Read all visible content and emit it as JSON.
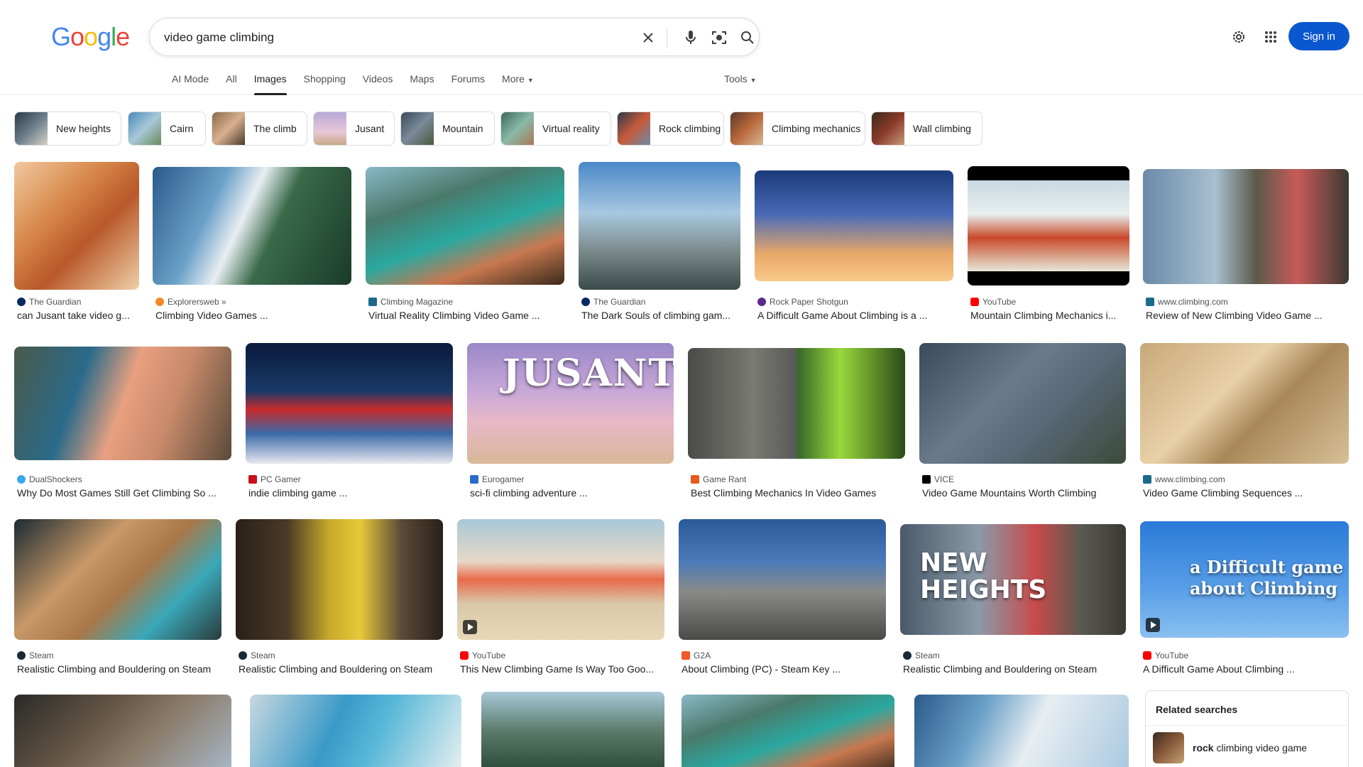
{
  "search": {
    "query": "video game climbing"
  },
  "header": {
    "sign_in": "Sign in"
  },
  "tabs": [
    {
      "label": "AI Mode"
    },
    {
      "label": "All"
    },
    {
      "label": "Images",
      "active": true
    },
    {
      "label": "Shopping"
    },
    {
      "label": "Videos"
    },
    {
      "label": "Maps"
    },
    {
      "label": "Forums"
    },
    {
      "label": "More"
    }
  ],
  "tools_label": "Tools",
  "chips": [
    {
      "label": "New heights"
    },
    {
      "label": "Cairn"
    },
    {
      "label": "The climb"
    },
    {
      "label": "Jusant"
    },
    {
      "label": "Mountain"
    },
    {
      "label": "Virtual reality"
    },
    {
      "label": "Rock climbing"
    },
    {
      "label": "Climbing mechanics"
    },
    {
      "label": "Wall climbing"
    }
  ],
  "results": [
    {
      "source": "The Guardian",
      "title": "can Jusant take video g..."
    },
    {
      "source": "Explorersweb »",
      "title": "Climbing Video Games ..."
    },
    {
      "source": "Climbing Magazine",
      "title": "Virtual Reality Climbing Video Game ..."
    },
    {
      "source": "The Guardian",
      "title": "The Dark Souls of climbing gam..."
    },
    {
      "source": "Rock Paper Shotgun",
      "title": "A Difficult Game About Climbing is a ..."
    },
    {
      "source": "YouTube",
      "title": "Mountain Climbing Mechanics i..."
    },
    {
      "source": "www.climbing.com",
      "title": "Review of New Climbing Video Game ..."
    },
    {
      "source": "DualShockers",
      "title": "Why Do Most Games Still Get Climbing So ..."
    },
    {
      "source": "PC Gamer",
      "title": "indie climbing game ..."
    },
    {
      "source": "Eurogamer",
      "title": "sci-fi climbing adventure ..."
    },
    {
      "source": "Game Rant",
      "title": "Best Climbing Mechanics In Video Games"
    },
    {
      "source": "VICE",
      "title": "Video Game Mountains Worth Climbing"
    },
    {
      "source": "www.climbing.com",
      "title": "Video Game Climbing Sequences ..."
    },
    {
      "source": "Steam",
      "title": "Realistic Climbing and Bouldering on Steam"
    },
    {
      "source": "Steam",
      "title": "Realistic Climbing and Bouldering on Steam"
    },
    {
      "source": "YouTube",
      "title": "This New Climbing Game Is Way Too Goo..."
    },
    {
      "source": "G2A",
      "title": "About Climbing (PC) - Steam Key ..."
    },
    {
      "source": "Steam",
      "title": "Realistic Climbing and Bouldering on Steam"
    },
    {
      "source": "YouTube",
      "title": "A Difficult Game About Climbing ..."
    }
  ],
  "overlays": {
    "jusant": "JUSANT",
    "new_heights": "NEW HEIGHTS",
    "difficult_1": "a Difficult game",
    "difficult_2": "about Climbing"
  },
  "related": {
    "title": "Related searches",
    "item_bold": "rock",
    "item_rest": " climbing video game"
  },
  "colors": {
    "accent": "#0b57d0",
    "guardian": "#052962",
    "youtube": "#ff0000",
    "steam": "#1b2838"
  }
}
